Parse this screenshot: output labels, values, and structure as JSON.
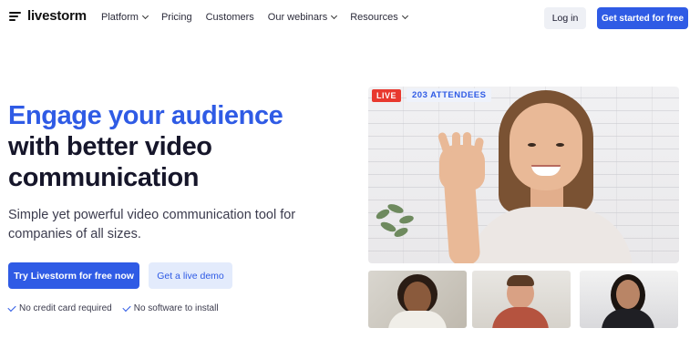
{
  "brand": {
    "name": "livestorm"
  },
  "nav": {
    "items": [
      {
        "label": "Platform",
        "has_dropdown": true
      },
      {
        "label": "Pricing",
        "has_dropdown": false
      },
      {
        "label": "Customers",
        "has_dropdown": false
      },
      {
        "label": "Our webinars",
        "has_dropdown": true
      },
      {
        "label": "Resources",
        "has_dropdown": true
      }
    ],
    "login_label": "Log in",
    "cta_label": "Get started for free"
  },
  "hero": {
    "title_accent": "Engage your audience",
    "title_line2": "with better video",
    "title_line3": "communication",
    "subtitle": "Simple yet powerful video communication tool for companies of all sizes.",
    "primary_cta": "Try Livestorm for free now",
    "secondary_cta": "Get a live demo",
    "checks": [
      "No credit card required",
      "No software to install"
    ]
  },
  "video": {
    "live_label": "LIVE",
    "attendees_label": "203 ATTENDEES"
  },
  "colors": {
    "brand_blue": "#2f5be5",
    "live_red": "#e8392f",
    "light_blue": "#e3ebfc"
  }
}
